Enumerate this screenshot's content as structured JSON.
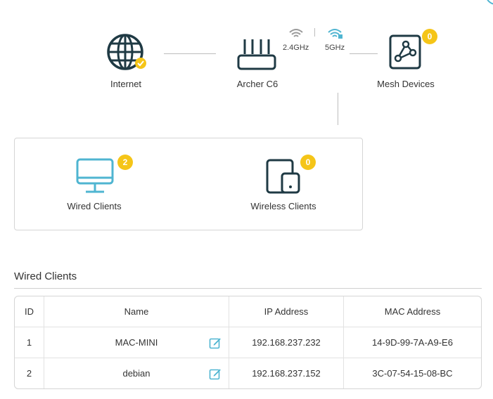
{
  "topology": {
    "internet_label": "Internet",
    "router_label": "Archer C6",
    "band_24": "2.4GHz",
    "band_5": "5GHz",
    "mesh_label": "Mesh Devices",
    "mesh_count": "0"
  },
  "clients_panel": {
    "wired_label": "Wired Clients",
    "wired_count": "2",
    "wireless_label": "Wireless Clients",
    "wireless_count": "0"
  },
  "wired_section": {
    "title": "Wired Clients",
    "columns": [
      "ID",
      "Name",
      "IP Address",
      "MAC Address"
    ],
    "rows": [
      {
        "id": "1",
        "name": "MAC-MINI",
        "ip": "192.168.237.232",
        "mac": "14-9D-99-7A-A9-E6"
      },
      {
        "id": "2",
        "name": "debian",
        "ip": "192.168.237.152",
        "mac": "3C-07-54-15-08-BC"
      }
    ]
  },
  "colors": {
    "dark": "#1f3a44",
    "accent": "#4fb5d1",
    "badge": "#f5c518"
  },
  "icons": {
    "internet": "globe-icon",
    "router": "router-icon",
    "wifi": "wifi-icon",
    "mesh": "mesh-icon",
    "wired": "monitor-icon",
    "wireless": "tablet-icon",
    "edit": "edit-icon"
  }
}
